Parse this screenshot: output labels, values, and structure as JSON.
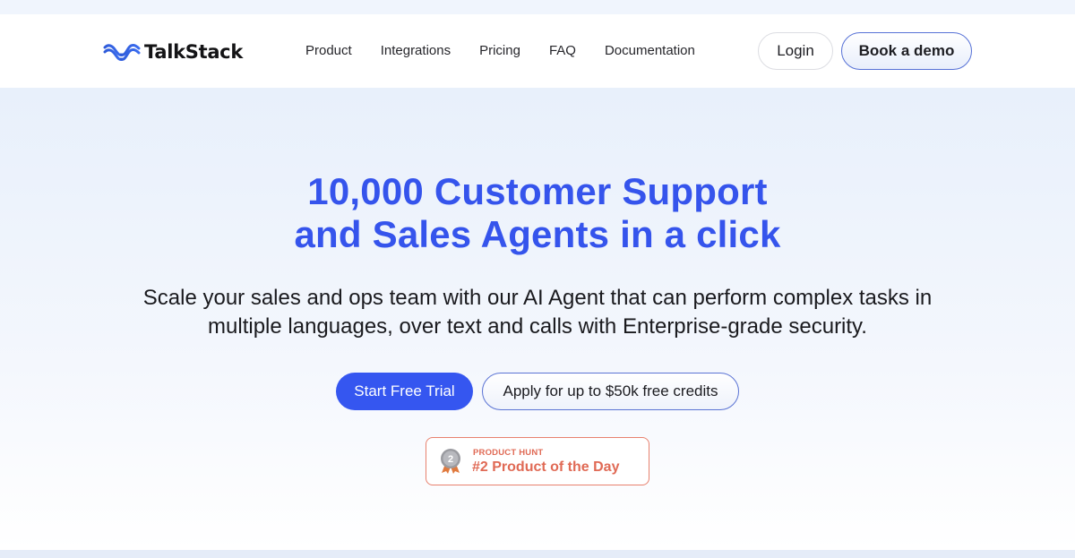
{
  "brand": {
    "name": "TalkStack",
    "accent_color": "#3554ec",
    "logo_icon": "wave-logo-icon"
  },
  "nav": {
    "links": [
      {
        "label": "Product"
      },
      {
        "label": "Integrations"
      },
      {
        "label": "Pricing"
      },
      {
        "label": "FAQ"
      },
      {
        "label": "Documentation"
      }
    ],
    "login_label": "Login",
    "demo_label": "Book a demo"
  },
  "hero": {
    "headline_line1": "10,000 Customer Support",
    "headline_line2": "and Sales Agents in a click",
    "subtitle_line1": "Scale your sales and ops team with our AI Agent that can perform complex tasks in",
    "subtitle_line2": "multiple languages, over text and calls with Enterprise-grade security.",
    "primary_cta": "Start Free Trial",
    "secondary_cta": "Apply for up to $50k free credits"
  },
  "badge": {
    "source": "PRODUCT HUNT",
    "title": "#2 Product of the Day",
    "medal_number": "2",
    "medal_icon": "silver-medal-icon",
    "color": "#e06a55"
  }
}
